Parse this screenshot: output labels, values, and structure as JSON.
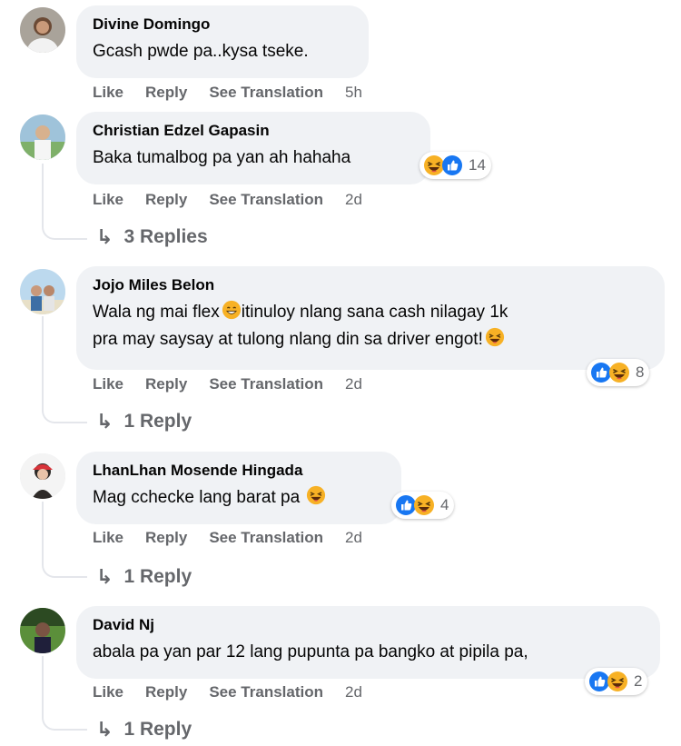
{
  "comments": [
    {
      "author": "Divine Domingo",
      "text": "Gcash pwde pa..kysa tseke.",
      "actions": {
        "like": "Like",
        "reply": "Reply",
        "translate": "See Translation",
        "time": "5h"
      }
    },
    {
      "author": "Christian Edzel Gapasin",
      "text": "Baka tumalbog pa yan ah hahaha",
      "reactions": {
        "icons": [
          "haha-icon",
          "like-icon"
        ],
        "count": "14"
      },
      "actions": {
        "like": "Like",
        "reply": "Reply",
        "translate": "See Translation",
        "time": "2d"
      },
      "replies": "3 Replies"
    },
    {
      "author": "Jojo Miles Belon",
      "text_line1a": "Wala ng mai flex",
      "text_line1b": "itinuloy nlang sana cash nilagay 1k",
      "text_line2": "pra may saysay at tulong nlang din sa driver engot!",
      "reactions": {
        "icons": [
          "like-icon",
          "haha-icon"
        ],
        "count": "8"
      },
      "actions": {
        "like": "Like",
        "reply": "Reply",
        "translate": "See Translation",
        "time": "2d"
      },
      "replies": "1 Reply"
    },
    {
      "author": "LhanLhan Mosende Hingada",
      "text": "Mag cchecke lang barat pa",
      "reactions": {
        "icons": [
          "like-icon",
          "haha-icon"
        ],
        "count": "4"
      },
      "actions": {
        "like": "Like",
        "reply": "Reply",
        "translate": "See Translation",
        "time": "2d"
      },
      "replies": "1 Reply"
    },
    {
      "author": "David Nj",
      "text": "abala pa yan par 12 lang pupunta pa bangko at pipila pa,",
      "reactions": {
        "icons": [
          "like-icon",
          "haha-icon"
        ],
        "count": "2"
      },
      "actions": {
        "like": "Like",
        "reply": "Reply",
        "translate": "See Translation",
        "time": "2d"
      },
      "replies": "1 Reply"
    }
  ],
  "colors": {
    "bubble": "#f0f2f5",
    "meta": "#65676b",
    "like_blue": "#1877f2",
    "haha_yellow": "#f7b125"
  }
}
